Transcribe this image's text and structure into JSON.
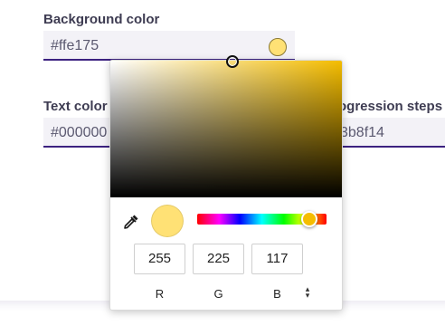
{
  "form": {
    "background_color": {
      "label": "Background color",
      "value": "#ffe175",
      "swatch": "#ffe175"
    },
    "text_color": {
      "label": "Text color",
      "value": "#000000"
    },
    "progression_steps": {
      "label": "ogression steps",
      "value": "3b8f14"
    }
  },
  "picker": {
    "base_hue": "#f5bd00",
    "current_color": "#ffe175",
    "hue_fraction": 0.87,
    "channels": [
      {
        "label": "R",
        "value": "255"
      },
      {
        "label": "G",
        "value": "225"
      },
      {
        "label": "B",
        "value": "117"
      }
    ],
    "eyedropper_icon": "eyedropper-icon",
    "format_toggle_icon": "up-down-arrows-icon"
  }
}
